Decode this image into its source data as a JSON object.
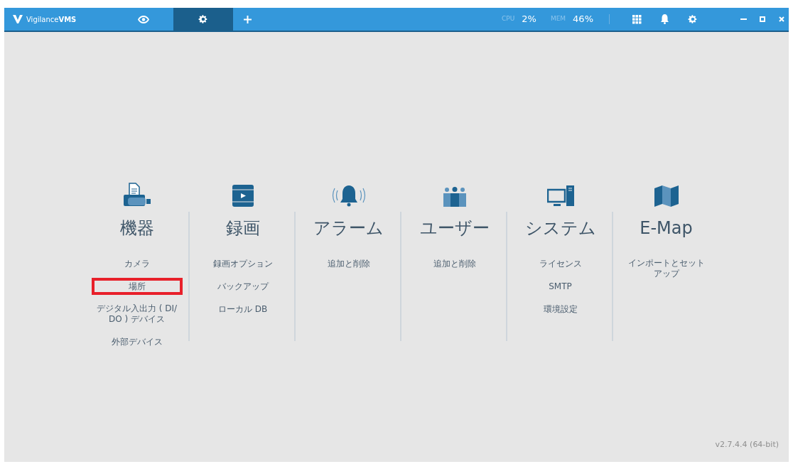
{
  "app": {
    "logo": "Vigilance",
    "logo_bold": "VMS"
  },
  "tabs": [
    {
      "kind": "eye",
      "selected": false
    },
    {
      "kind": "gear",
      "selected": true
    },
    {
      "kind": "plus",
      "selected": false
    }
  ],
  "stats": [
    {
      "label": "CPU",
      "value": "2%"
    },
    {
      "label": "MEM",
      "value": "46%"
    }
  ],
  "categories": [
    {
      "kind": "devices",
      "title": "機器",
      "items": [
        {
          "label": "カメラ",
          "highlighted": false
        },
        {
          "label": "場所",
          "highlighted": true
        },
        {
          "label": "デジタル入出力 ( DI/ DO ) デバイス",
          "highlighted": false
        },
        {
          "label": "外部デバイス",
          "highlighted": false
        }
      ]
    },
    {
      "kind": "recording",
      "title": "録画",
      "items": [
        {
          "label": "録画オプション",
          "highlighted": false
        },
        {
          "label": "バックアップ",
          "highlighted": false
        },
        {
          "label": "ローカル DB",
          "highlighted": false
        }
      ]
    },
    {
      "kind": "alarm",
      "title": "アラーム",
      "items": [
        {
          "label": "追加と削除",
          "highlighted": false
        }
      ]
    },
    {
      "kind": "users",
      "title": "ユーザー",
      "items": [
        {
          "label": "追加と削除",
          "highlighted": false
        }
      ]
    },
    {
      "kind": "system",
      "title": "システム",
      "items": [
        {
          "label": "ライセンス",
          "highlighted": false
        },
        {
          "label": "SMTP",
          "highlighted": false
        },
        {
          "label": "環境設定",
          "highlighted": false
        }
      ]
    },
    {
      "kind": "map",
      "title": "E-Map",
      "items": [
        {
          "label": "インポートとセットアップ",
          "highlighted": false
        }
      ]
    }
  ],
  "version": "v2.7.4.4 (64-bit)"
}
